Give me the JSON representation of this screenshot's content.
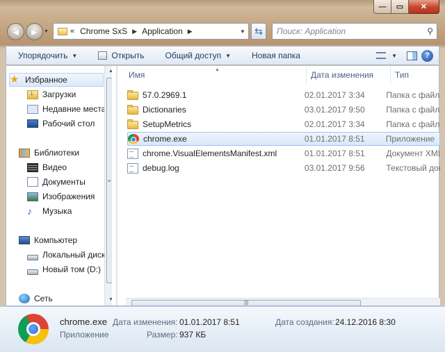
{
  "window": {
    "caption_buttons": {
      "minimize": "—",
      "maximize": "▭",
      "close": "✕"
    }
  },
  "navbar": {
    "back_icon": "arrow-left-icon",
    "forward_icon": "arrow-right-icon",
    "overflow": "«",
    "breadcrumbs": [
      "Chrome SxS",
      "Application"
    ],
    "search_placeholder": "Поиск: Application"
  },
  "toolbar": {
    "organize": "Упорядочить",
    "open": "Открыть",
    "share": "Общий доступ",
    "new_folder": "Новая папка"
  },
  "sidebar": {
    "items": [
      {
        "label": "Избранное",
        "icon": "star-icon"
      },
      {
        "label": "Загрузки",
        "icon": "downloads-icon"
      },
      {
        "label": "Недавние места",
        "icon": "recent-places-icon"
      },
      {
        "label": "Рабочий стол",
        "icon": "desktop-icon"
      },
      {
        "label": "Библиотеки",
        "icon": "libraries-icon"
      },
      {
        "label": "Видео",
        "icon": "video-icon"
      },
      {
        "label": "Документы",
        "icon": "documents-icon"
      },
      {
        "label": "Изображения",
        "icon": "pictures-icon"
      },
      {
        "label": "Музыка",
        "icon": "music-icon"
      },
      {
        "label": "Компьютер",
        "icon": "computer-icon"
      },
      {
        "label": "Локальный диск",
        "icon": "disk-icon"
      },
      {
        "label": "Новый том (D:)",
        "icon": "disk-icon"
      },
      {
        "label": "Сеть",
        "icon": "network-icon"
      }
    ]
  },
  "filelist": {
    "columns": {
      "name": "Имя",
      "date": "Дата изменения",
      "type": "Тип"
    },
    "rows": [
      {
        "name": "57.0.2969.1",
        "date": "02.01.2017 3:34",
        "type": "Папка с файлами",
        "icon": "folder-icon"
      },
      {
        "name": "Dictionaries",
        "date": "03.01.2017 9:50",
        "type": "Папка с файлами",
        "icon": "folder-icon"
      },
      {
        "name": "SetupMetrics",
        "date": "02.01.2017 3:34",
        "type": "Папка с файлами",
        "icon": "folder-icon"
      },
      {
        "name": "chrome.exe",
        "date": "01.01.2017 8:51",
        "type": "Приложение",
        "icon": "chrome-icon"
      },
      {
        "name": "chrome.VisualElementsManifest.xml",
        "date": "01.01.2017 8:51",
        "type": "Документ XML",
        "icon": "xml-file-icon"
      },
      {
        "name": "debug.log",
        "date": "03.01.2017 9:56",
        "type": "Текстовый документ",
        "icon": "text-file-icon"
      }
    ]
  },
  "details": {
    "name": "chrome.exe",
    "kind": "Приложение",
    "modified_label": "Дата изменения:",
    "modified_value": "01.01.2017 8:51",
    "created_label": "Дата создания:",
    "created_value": "24.12.2016 8:30",
    "size_label": "Размер:",
    "size_value": "937 КБ"
  }
}
